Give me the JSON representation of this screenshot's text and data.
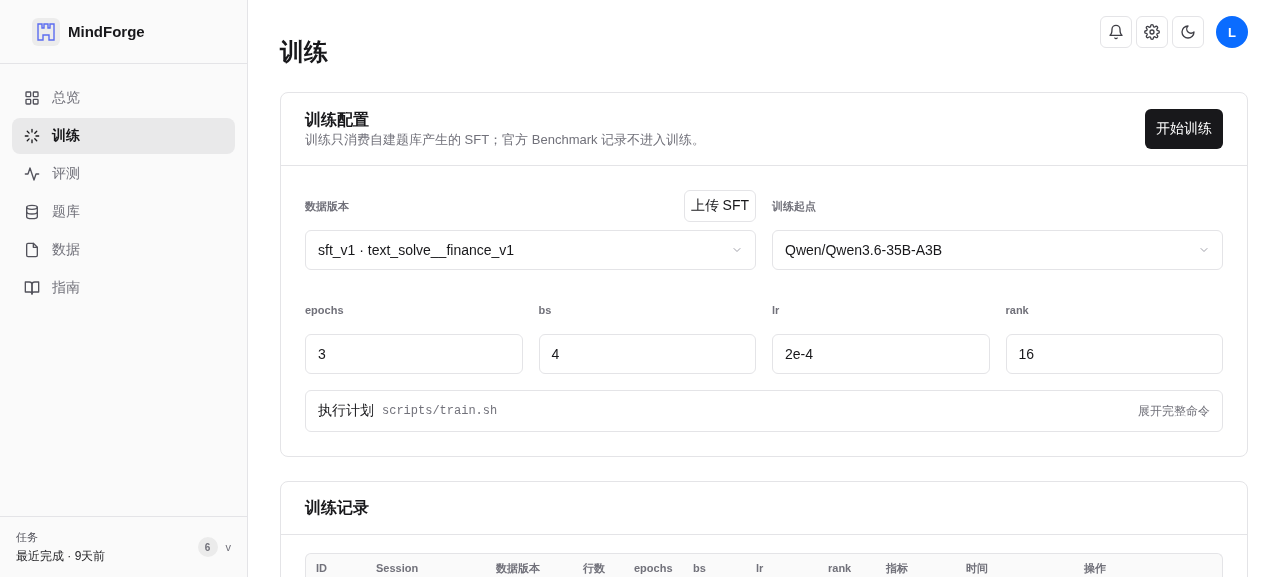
{
  "brand": {
    "name": "MindForge"
  },
  "nav": [
    {
      "label": "总览",
      "selected": false
    },
    {
      "label": "训练",
      "selected": true
    },
    {
      "label": "评测",
      "selected": false
    },
    {
      "label": "题库",
      "selected": false
    },
    {
      "label": "数据",
      "selected": false
    },
    {
      "label": "指南",
      "selected": false
    }
  ],
  "task_footer": {
    "title": "任务",
    "status": "最近完成 · 9天前",
    "count": "6",
    "toggle": "v"
  },
  "header": {
    "avatar": "L"
  },
  "page_title": "训练",
  "config": {
    "title": "训练配置",
    "subtitle": "训练只消费自建题库产生的 SFT；官方 Benchmark 记录不进入训练。",
    "start_button": "开始训练",
    "data_version": {
      "label": "数据版本",
      "upload_button": "上传 SFT",
      "value": "sft_v1 · text_solve__finance_v1"
    },
    "base_model": {
      "label": "训练起点",
      "value": "Qwen/Qwen3.6-35B-A3B"
    },
    "params": [
      {
        "label": "epochs",
        "value": "3"
      },
      {
        "label": "bs",
        "value": "4"
      },
      {
        "label": "lr",
        "value": "2e-4"
      },
      {
        "label": "rank",
        "value": "16"
      }
    ],
    "plan": {
      "label": "执行计划",
      "command": "scripts/train.sh",
      "expand_link": "展开完整命令"
    }
  },
  "records": {
    "title": "训练记录",
    "columns": [
      "ID",
      "Session",
      "数据版本",
      "行数",
      "epochs",
      "bs",
      "lr",
      "rank",
      "指标",
      "时间",
      "操作"
    ]
  }
}
